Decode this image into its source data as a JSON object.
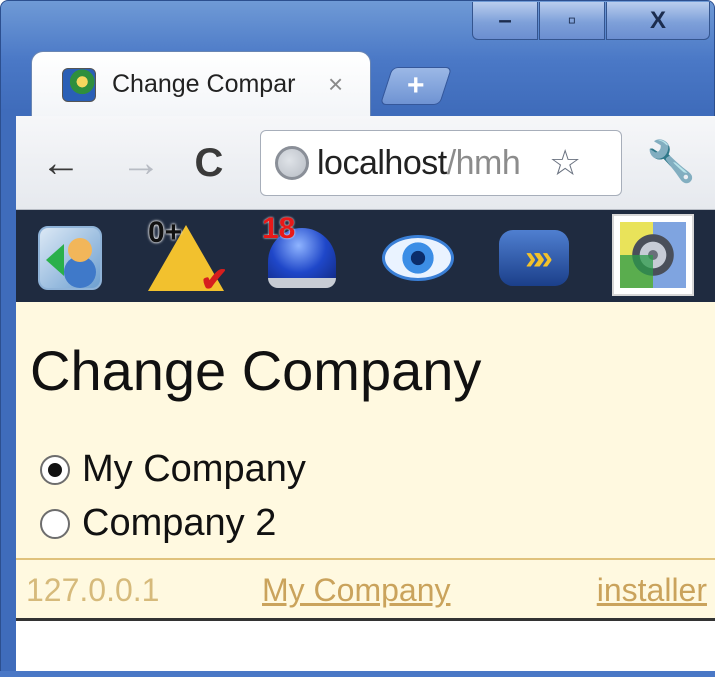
{
  "window": {
    "controls": {
      "minimize": "–",
      "maximize": "▫",
      "close": "X"
    }
  },
  "tab": {
    "title": "Change Compar",
    "close_symbol": "×"
  },
  "new_tab_symbol": "+",
  "toolbar": {
    "back_symbol": "←",
    "forward_symbol": "→",
    "reload_symbol": "C",
    "url_host": "localhost",
    "url_path": "/hmh",
    "star_symbol": "☆",
    "wrench_symbol": "🔧"
  },
  "appbar": {
    "badge_zero": "0+",
    "badge_count": "18",
    "icons": [
      "contacts-icon",
      "warning-icon",
      "siren-icon",
      "eye-icon",
      "forward-arrows-icon",
      "camera-icon"
    ],
    "arrows_glyph": "»»"
  },
  "content": {
    "title": "Change Company",
    "options": [
      {
        "label": "My Company",
        "selected": true
      },
      {
        "label": "Company 2",
        "selected": false
      }
    ]
  },
  "footer": {
    "ip": "127.0.0.1",
    "company_link": "My Company",
    "user_link": "installer"
  },
  "colors": {
    "content_bg": "#fff9e0",
    "appbar_bg": "#1f2b40",
    "footer_text": "#d6ba7b",
    "chrome_blue": "#4a78c6"
  }
}
